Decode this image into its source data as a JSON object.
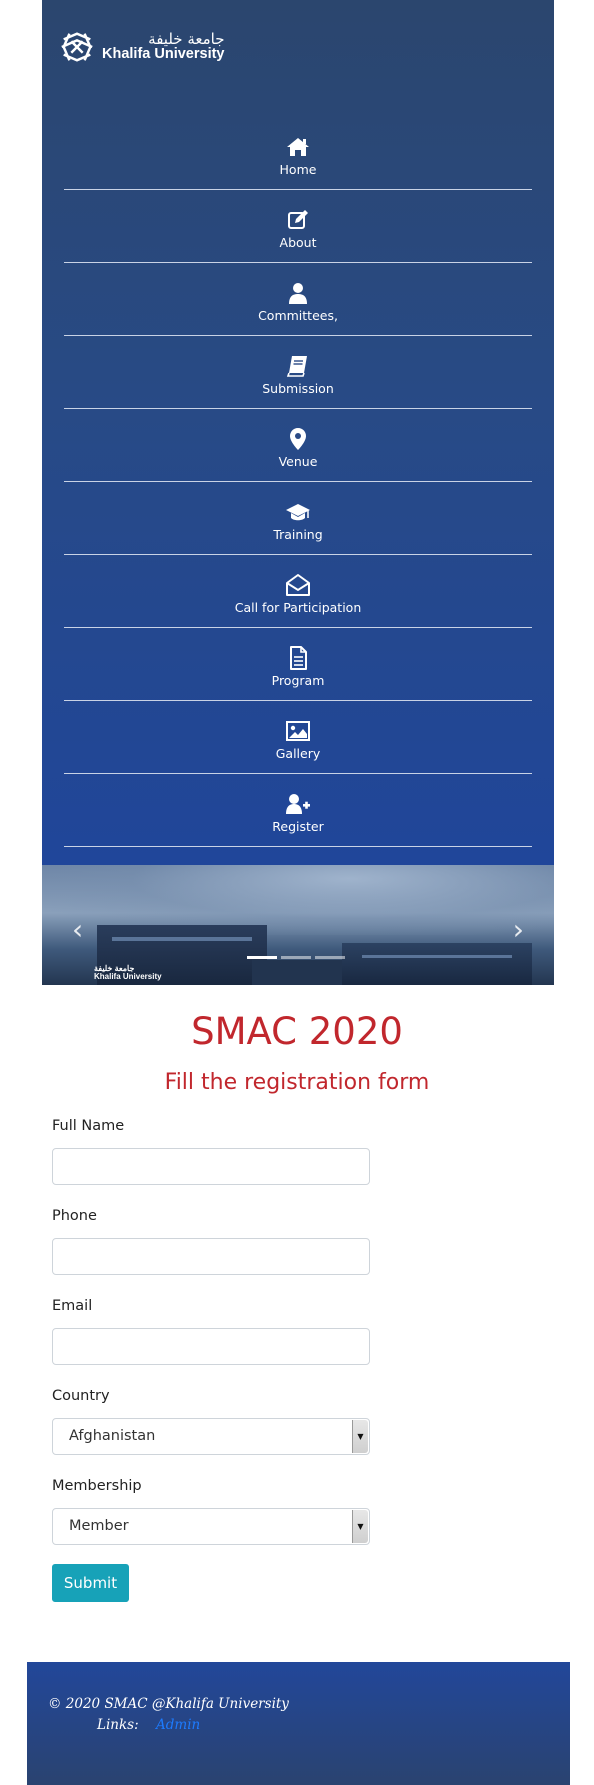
{
  "brand": {
    "name_ar": "جامعة خليفة",
    "name_en": "Khalifa University"
  },
  "nav": {
    "items": [
      {
        "label": "Home",
        "icon": "home-icon"
      },
      {
        "label": "About",
        "icon": "edit-icon"
      },
      {
        "label": "Committees,",
        "icon": "user-icon"
      },
      {
        "label": "Submission",
        "icon": "book-icon"
      },
      {
        "label": "Venue",
        "icon": "map-marker-icon"
      },
      {
        "label": "Training",
        "icon": "graduation-cap-icon"
      },
      {
        "label": "Call for Participation",
        "icon": "envelope-open-icon"
      },
      {
        "label": "Program",
        "icon": "document-icon"
      },
      {
        "label": "Gallery",
        "icon": "image-icon"
      },
      {
        "label": "Register",
        "icon": "user-plus-icon"
      }
    ]
  },
  "carousel": {
    "prev": "‹",
    "next": "›",
    "logo_ar": "جامعة خليفة",
    "logo_en": "Khalifa University",
    "slides": 3,
    "active_slide": 1
  },
  "form": {
    "title": "SMAC 2020",
    "subtitle": "Fill the registration form",
    "full_name_label": "Full Name",
    "full_name_value": "",
    "phone_label": "Phone",
    "phone_value": "",
    "email_label": "Email",
    "email_value": "",
    "country_label": "Country",
    "country_value": "Afghanistan",
    "membership_label": "Membership",
    "membership_value": "Member",
    "submit_label": "Submit"
  },
  "footer": {
    "copyright": "© 2020 SMAC @Khalifa University",
    "links_label": "Links:",
    "admin_link": "Admin"
  },
  "colors": {
    "header_blue": "#284a85",
    "title_red": "#c1272d",
    "submit_teal": "#17a2b8",
    "link_blue": "#1d7bff"
  }
}
